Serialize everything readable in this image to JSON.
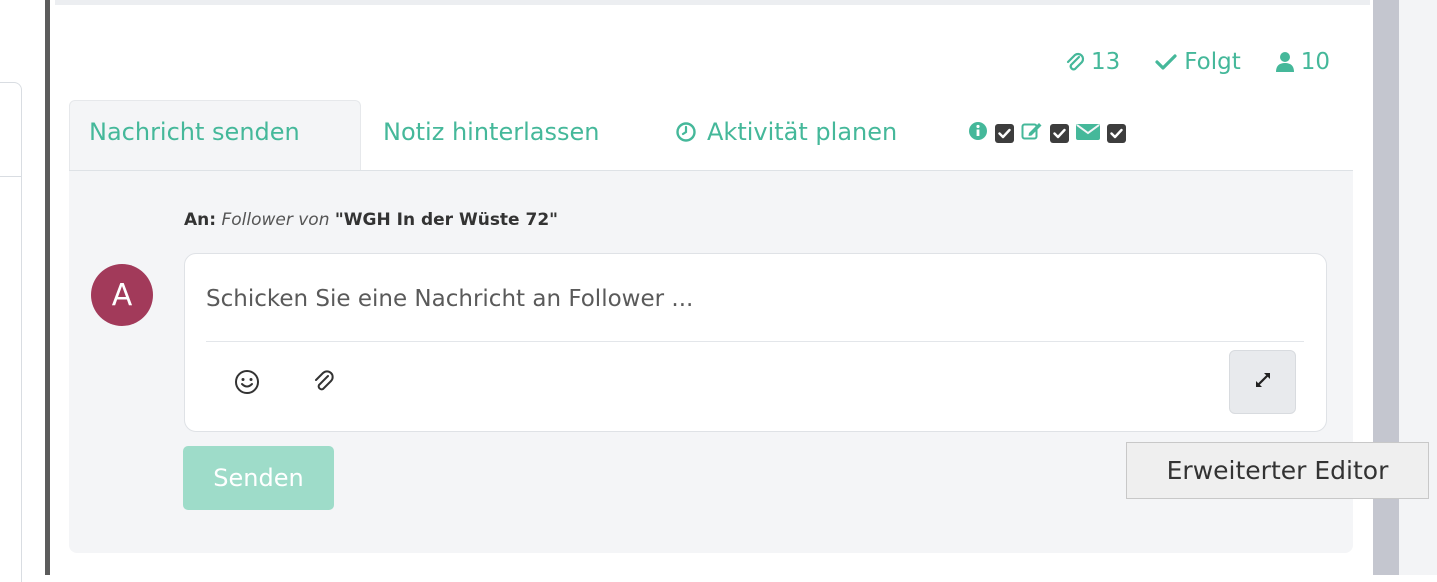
{
  "header": {
    "attachments_count": "13",
    "follow_label": "Folgt",
    "followers_count": "10"
  },
  "tabs": [
    {
      "label": "Nachricht senden",
      "active": true
    },
    {
      "label": "Notiz hinterlassen",
      "active": false
    },
    {
      "label": "Aktivität planen",
      "active": false
    }
  ],
  "composer": {
    "recipient_prefix": "An:",
    "recipient_role": "Follower von",
    "recipient_name": "\"WGH In der Wüste 72\"",
    "avatar_initial": "A",
    "placeholder": "Schicken Sie eine Nachricht an Follower ...",
    "send_label": "Senden",
    "expand_tooltip": "Erweiterter Editor"
  },
  "colors": {
    "accent": "#45b89a",
    "avatar": "#a23a5a",
    "send_disabled": "#9edcc9"
  },
  "icons": [
    "paperclip-icon",
    "check-icon",
    "user-icon",
    "clock-icon",
    "info-icon",
    "checkbox-icon",
    "edit-icon",
    "envelope-icon",
    "smiley-icon",
    "expand-icon"
  ]
}
